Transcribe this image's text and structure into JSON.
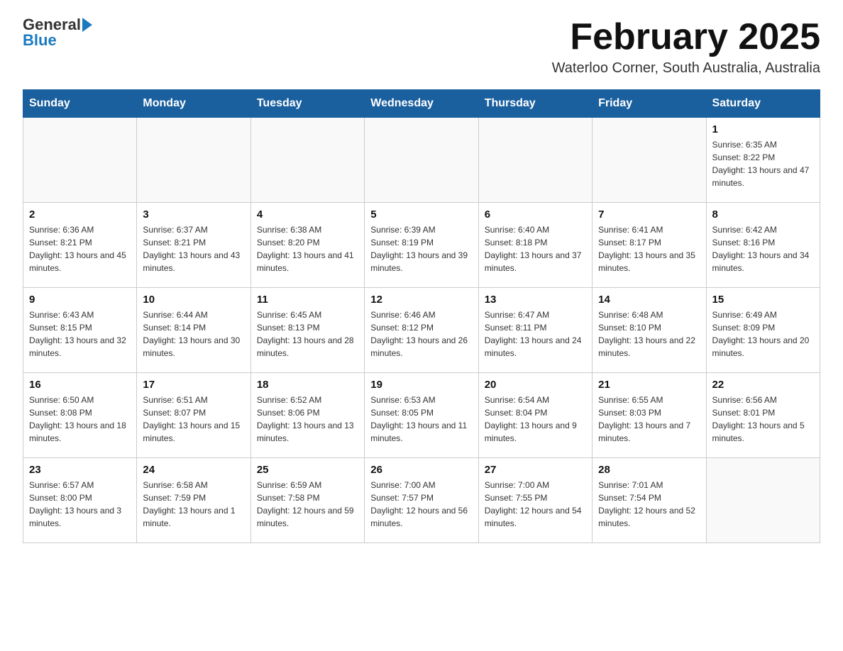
{
  "logo": {
    "general": "General",
    "blue": "Blue",
    "tagline": ""
  },
  "title": "February 2025",
  "subtitle": "Waterloo Corner, South Australia, Australia",
  "weekdays": [
    "Sunday",
    "Monday",
    "Tuesday",
    "Wednesday",
    "Thursday",
    "Friday",
    "Saturday"
  ],
  "weeks": [
    [
      {
        "day": "",
        "info": ""
      },
      {
        "day": "",
        "info": ""
      },
      {
        "day": "",
        "info": ""
      },
      {
        "day": "",
        "info": ""
      },
      {
        "day": "",
        "info": ""
      },
      {
        "day": "",
        "info": ""
      },
      {
        "day": "1",
        "info": "Sunrise: 6:35 AM\nSunset: 8:22 PM\nDaylight: 13 hours and 47 minutes."
      }
    ],
    [
      {
        "day": "2",
        "info": "Sunrise: 6:36 AM\nSunset: 8:21 PM\nDaylight: 13 hours and 45 minutes."
      },
      {
        "day": "3",
        "info": "Sunrise: 6:37 AM\nSunset: 8:21 PM\nDaylight: 13 hours and 43 minutes."
      },
      {
        "day": "4",
        "info": "Sunrise: 6:38 AM\nSunset: 8:20 PM\nDaylight: 13 hours and 41 minutes."
      },
      {
        "day": "5",
        "info": "Sunrise: 6:39 AM\nSunset: 8:19 PM\nDaylight: 13 hours and 39 minutes."
      },
      {
        "day": "6",
        "info": "Sunrise: 6:40 AM\nSunset: 8:18 PM\nDaylight: 13 hours and 37 minutes."
      },
      {
        "day": "7",
        "info": "Sunrise: 6:41 AM\nSunset: 8:17 PM\nDaylight: 13 hours and 35 minutes."
      },
      {
        "day": "8",
        "info": "Sunrise: 6:42 AM\nSunset: 8:16 PM\nDaylight: 13 hours and 34 minutes."
      }
    ],
    [
      {
        "day": "9",
        "info": "Sunrise: 6:43 AM\nSunset: 8:15 PM\nDaylight: 13 hours and 32 minutes."
      },
      {
        "day": "10",
        "info": "Sunrise: 6:44 AM\nSunset: 8:14 PM\nDaylight: 13 hours and 30 minutes."
      },
      {
        "day": "11",
        "info": "Sunrise: 6:45 AM\nSunset: 8:13 PM\nDaylight: 13 hours and 28 minutes."
      },
      {
        "day": "12",
        "info": "Sunrise: 6:46 AM\nSunset: 8:12 PM\nDaylight: 13 hours and 26 minutes."
      },
      {
        "day": "13",
        "info": "Sunrise: 6:47 AM\nSunset: 8:11 PM\nDaylight: 13 hours and 24 minutes."
      },
      {
        "day": "14",
        "info": "Sunrise: 6:48 AM\nSunset: 8:10 PM\nDaylight: 13 hours and 22 minutes."
      },
      {
        "day": "15",
        "info": "Sunrise: 6:49 AM\nSunset: 8:09 PM\nDaylight: 13 hours and 20 minutes."
      }
    ],
    [
      {
        "day": "16",
        "info": "Sunrise: 6:50 AM\nSunset: 8:08 PM\nDaylight: 13 hours and 18 minutes."
      },
      {
        "day": "17",
        "info": "Sunrise: 6:51 AM\nSunset: 8:07 PM\nDaylight: 13 hours and 15 minutes."
      },
      {
        "day": "18",
        "info": "Sunrise: 6:52 AM\nSunset: 8:06 PM\nDaylight: 13 hours and 13 minutes."
      },
      {
        "day": "19",
        "info": "Sunrise: 6:53 AM\nSunset: 8:05 PM\nDaylight: 13 hours and 11 minutes."
      },
      {
        "day": "20",
        "info": "Sunrise: 6:54 AM\nSunset: 8:04 PM\nDaylight: 13 hours and 9 minutes."
      },
      {
        "day": "21",
        "info": "Sunrise: 6:55 AM\nSunset: 8:03 PM\nDaylight: 13 hours and 7 minutes."
      },
      {
        "day": "22",
        "info": "Sunrise: 6:56 AM\nSunset: 8:01 PM\nDaylight: 13 hours and 5 minutes."
      }
    ],
    [
      {
        "day": "23",
        "info": "Sunrise: 6:57 AM\nSunset: 8:00 PM\nDaylight: 13 hours and 3 minutes."
      },
      {
        "day": "24",
        "info": "Sunrise: 6:58 AM\nSunset: 7:59 PM\nDaylight: 13 hours and 1 minute."
      },
      {
        "day": "25",
        "info": "Sunrise: 6:59 AM\nSunset: 7:58 PM\nDaylight: 12 hours and 59 minutes."
      },
      {
        "day": "26",
        "info": "Sunrise: 7:00 AM\nSunset: 7:57 PM\nDaylight: 12 hours and 56 minutes."
      },
      {
        "day": "27",
        "info": "Sunrise: 7:00 AM\nSunset: 7:55 PM\nDaylight: 12 hours and 54 minutes."
      },
      {
        "day": "28",
        "info": "Sunrise: 7:01 AM\nSunset: 7:54 PM\nDaylight: 12 hours and 52 minutes."
      },
      {
        "day": "",
        "info": ""
      }
    ]
  ]
}
